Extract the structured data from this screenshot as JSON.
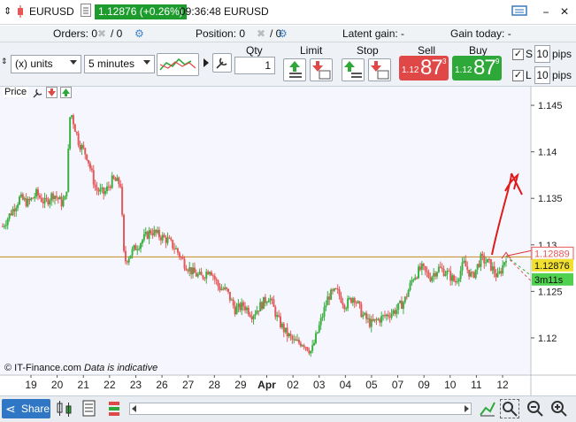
{
  "titlebar": {
    "symbol": "EURUSD",
    "price_change": "1.12876 (+0.26%)",
    "time_pair": "09:36:48 EURUSD",
    "menu_icon": "keyboard-icon",
    "minimize": "−",
    "close": "×"
  },
  "status_row": {
    "orders_label": "Orders: 0",
    "orders_rest": "/ 0",
    "position_label": "Position: 0",
    "position_rest": "/ 0",
    "latent_gain": "Latent gain: -",
    "gain_today": "Gain today: -"
  },
  "toolbar": {
    "units": "(x) units",
    "interval": "5 minutes",
    "qty_label": "Qty",
    "qty_value": "1",
    "limit_label": "Limit",
    "stop_label": "Stop",
    "sell_label": "Sell",
    "buy_label": "Buy",
    "sell_prefix": "1.12",
    "sell_big": "87",
    "sell_sup": "3",
    "buy_prefix": "1.12",
    "buy_big": "87",
    "buy_sup": "9",
    "s_label": "S",
    "l_label": "L",
    "s_pips": "10",
    "l_pips": "10",
    "pips_label": "pips"
  },
  "chart": {
    "price_label": "Price",
    "credit": "© IT-Finance.com",
    "credit_note": "Data is indicative",
    "marker_price": "1.12889",
    "last_price": "1.12876",
    "timer": "3m11s",
    "colors": {
      "up": "#3cb043",
      "down": "#e45a5a",
      "hline": "#c9963a",
      "bg": "#f6f7fe",
      "annotation": "#e01b1b"
    }
  },
  "chart_data": {
    "type": "candlestick",
    "ylim": [
      1.116,
      1.147
    ],
    "yticks": [
      1.12,
      1.125,
      1.13,
      1.135,
      1.14,
      1.145
    ],
    "ytick_labels": [
      "1.12",
      "1.125",
      "1.13",
      "1.135",
      "1.14",
      "1.145"
    ],
    "xtick_labels": [
      "19",
      "20",
      "21",
      "22",
      "23",
      "26",
      "27",
      "28",
      "29",
      "Apr",
      "02",
      "03",
      "04",
      "05",
      "07",
      "09",
      "10",
      "11",
      "12"
    ],
    "reference_level": 1.1287,
    "close_path": [
      [
        0,
        1.132
      ],
      [
        2,
        1.1335
      ],
      [
        4,
        1.135
      ],
      [
        6,
        1.1345
      ],
      [
        8,
        1.1355
      ],
      [
        10,
        1.1345
      ],
      [
        12,
        1.1355
      ],
      [
        14,
        1.1345
      ],
      [
        15,
        1.135
      ],
      [
        16,
        1.1445
      ],
      [
        18,
        1.141
      ],
      [
        20,
        1.1395
      ],
      [
        22,
        1.136
      ],
      [
        24,
        1.1355
      ],
      [
        26,
        1.137
      ],
      [
        28,
        1.1365
      ],
      [
        28.5,
        1.1293
      ],
      [
        29,
        1.1283
      ],
      [
        31,
        1.1295
      ],
      [
        33,
        1.1305
      ],
      [
        35,
        1.1315
      ],
      [
        37,
        1.131
      ],
      [
        39,
        1.1305
      ],
      [
        41,
        1.1295
      ],
      [
        43,
        1.128
      ],
      [
        45,
        1.127
      ],
      [
        47,
        1.1265
      ],
      [
        49,
        1.1275
      ],
      [
        51,
        1.1255
      ],
      [
        53,
        1.125
      ],
      [
        55,
        1.123
      ],
      [
        57,
        1.1235
      ],
      [
        59,
        1.1225
      ],
      [
        61,
        1.1235
      ],
      [
        63,
        1.1245
      ],
      [
        65,
        1.122
      ],
      [
        67,
        1.1205
      ],
      [
        69,
        1.1195
      ],
      [
        71,
        1.1195
      ],
      [
        73,
        1.1185
      ],
      [
        75,
        1.1215
      ],
      [
        77,
        1.1245
      ],
      [
        79,
        1.125
      ],
      [
        81,
        1.1235
      ],
      [
        83,
        1.1245
      ],
      [
        85,
        1.1225
      ],
      [
        87,
        1.1215
      ],
      [
        89,
        1.122
      ],
      [
        91,
        1.1225
      ],
      [
        93,
        1.123
      ],
      [
        95,
        1.124
      ],
      [
        97,
        1.1265
      ],
      [
        99,
        1.1275
      ],
      [
        101,
        1.1265
      ],
      [
        103,
        1.1275
      ],
      [
        105,
        1.127
      ],
      [
        107,
        1.126
      ],
      [
        109,
        1.128
      ],
      [
        111,
        1.1265
      ],
      [
        113,
        1.1285
      ],
      [
        115,
        1.128
      ],
      [
        117,
        1.1265
      ],
      [
        118,
        1.1275
      ],
      [
        119,
        1.1288
      ]
    ],
    "note": "Two-way EURUSD 5-minute candles, red down / green up"
  },
  "bottombar": {
    "share_label": "Share",
    "icons": [
      "candles-icon",
      "sheet-icon",
      "bars-icon",
      "scroll-left-icon",
      "scroll-right-icon",
      "drawing-icon",
      "zoom-fit-icon",
      "zoom-out-icon",
      "zoom-in-icon"
    ]
  }
}
